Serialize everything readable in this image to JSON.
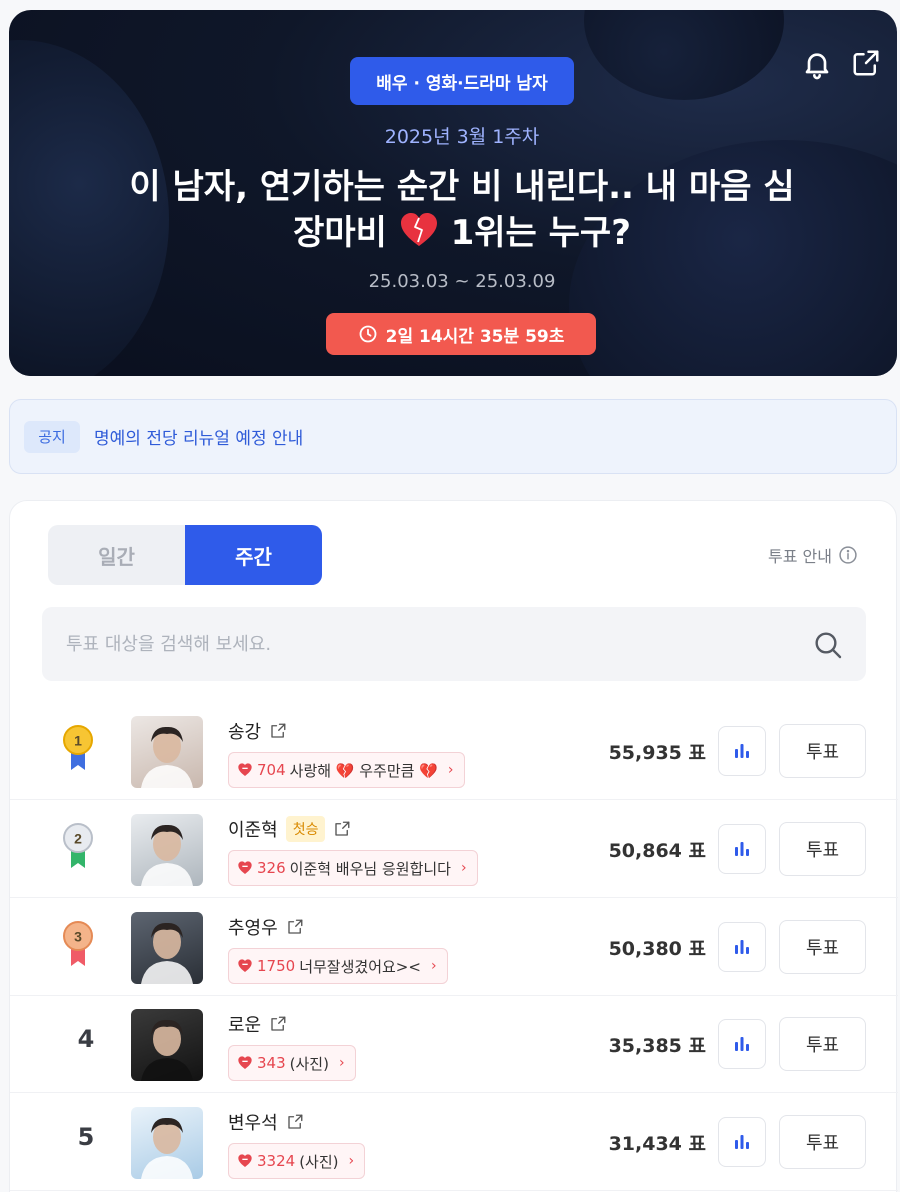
{
  "hero": {
    "category": "배우 · 영화·드라마 남자",
    "week": "2025년 3월 1주차",
    "title_line1": "이 남자, 연기하는 순간 비 내린다.. 내 마음 심",
    "title_line2_a": "장마비",
    "title_line2_b": "1위는 누구?",
    "dates": "25.03.03 ~ 25.03.09",
    "countdown": "2일 14시간 35분 59초",
    "icons": [
      "bell-icon",
      "share-icon",
      "clock-icon",
      "heart-icon"
    ]
  },
  "notice": {
    "badge": "공지",
    "text": "명예의 전당 리뉴얼 예정 안내"
  },
  "ranking": {
    "tabs": {
      "daily": "일간",
      "weekly": "주간"
    },
    "guide": "투표 안내",
    "search_placeholder": "투표 대상을 검색해 보세요.",
    "vote_label": "투표",
    "first_badge": "첫승",
    "rows": [
      {
        "rank": "1",
        "name": "송강",
        "count": "704",
        "msg": "사랑해 💔 우주만큼 💔",
        "votes": "55,935 표",
        "medal": "gold"
      },
      {
        "rank": "2",
        "name": "이준혁",
        "count": "326",
        "msg": "이준혁 배우님 응원합니다",
        "votes": "50,864 표",
        "medal": "silver",
        "first": true
      },
      {
        "rank": "3",
        "name": "추영우",
        "count": "1750",
        "msg": "너무잘생겼어요><",
        "votes": "50,380 표",
        "medal": "bronze"
      },
      {
        "rank": "4",
        "name": "로운",
        "count": "343",
        "msg": "(사진)",
        "votes": "35,385 표"
      },
      {
        "rank": "5",
        "name": "변우석",
        "count": "3324",
        "msg": "(사진)",
        "votes": "31,434 표"
      }
    ]
  },
  "colors": {
    "accent": "#2f5bea",
    "timer": "#f2594f",
    "heart": "#e6464f"
  }
}
